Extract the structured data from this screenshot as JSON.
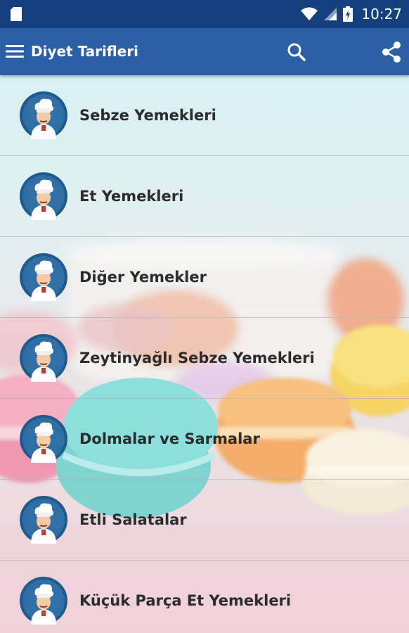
{
  "status_bar": {
    "time": "10:27",
    "icons": [
      "sd-card-icon",
      "wifi-icon",
      "signal-icon",
      "battery-icon"
    ]
  },
  "app_bar": {
    "title": "Diyet Tarifleri",
    "menu_icon": "hamburger-menu-icon",
    "search_icon": "search-icon",
    "share_icon": "share-icon",
    "color": "#2b5fa6",
    "status_color": "#163f7d"
  },
  "list": {
    "avatar_icon": "chef-avatar-icon",
    "items": [
      {
        "label": "Sebze Yemekleri"
      },
      {
        "label": "Et Yemekleri"
      },
      {
        "label": "Diğer Yemekler"
      },
      {
        "label": "Zeytinyağlı Sebze Yemekleri"
      },
      {
        "label": "Dolmalar ve Sarmalar"
      },
      {
        "label": "Etli Salatalar"
      },
      {
        "label": "Küçük Parça Et Yemekleri"
      }
    ]
  }
}
